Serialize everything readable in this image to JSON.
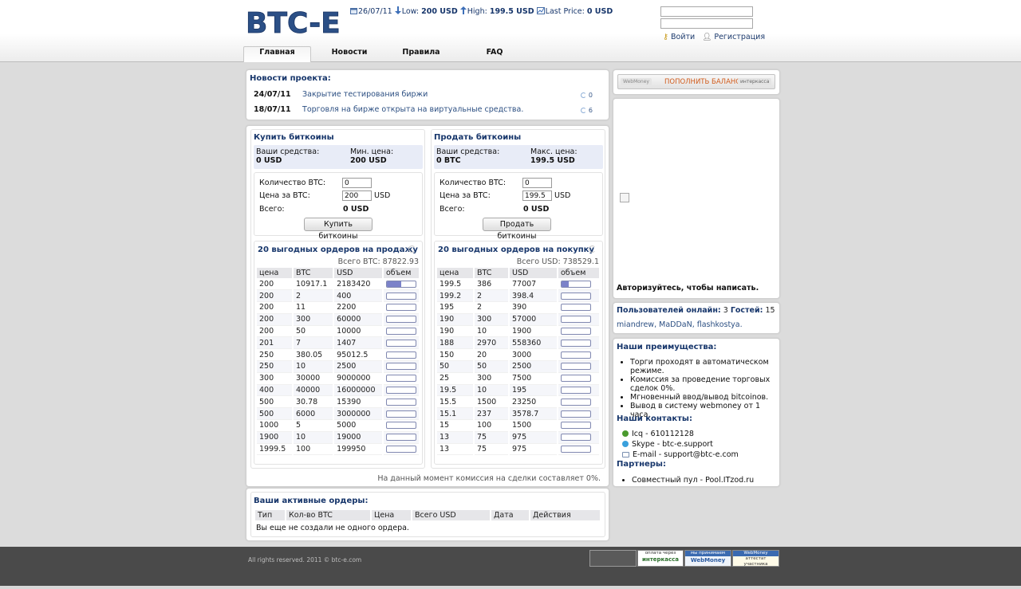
{
  "header": {
    "logo_text": "BTC-E",
    "ticker": {
      "date": "26/07/11",
      "low_label": "Low:",
      "low_value": "200 USD",
      "high_label": "High:",
      "high_value": "199.5 USD",
      "last_label": "Last Price:",
      "last_value": "0 USD"
    },
    "login": {
      "login_link": "Войти",
      "register_link": "Регистрация"
    },
    "nav": [
      "Главная",
      "Новости",
      "Правила",
      "FAQ"
    ]
  },
  "news": {
    "title": "Новости проекта:",
    "items": [
      {
        "date": "24/07/11",
        "text": "Закрытие тестирования биржи",
        "comments": "0"
      },
      {
        "date": "18/07/11",
        "text": "Торговля на бирже открыта на виртуальные средства.",
        "comments": "6"
      }
    ]
  },
  "buy": {
    "title": "Купить биткоины",
    "funds_label": "Ваши средства:",
    "funds_value": "0 USD",
    "price_label": "Мин. цена:",
    "price_value": "200 USD",
    "qty_label": "Количество BTC:",
    "qty_value": "0",
    "unit_price_label": "Цена за BTC:",
    "unit_price_value": "200",
    "unit_price_currency": "USD",
    "total_label": "Всего:",
    "total_value": "0 USD",
    "button": "Купить биткоины"
  },
  "sell": {
    "title": "Продать биткоины",
    "funds_label": "Ваши средства:",
    "funds_value": "0 BTC",
    "price_label": "Макс. цена:",
    "price_value": "199.5 USD",
    "qty_label": "Количество BTC:",
    "qty_value": "0",
    "unit_price_label": "Цена за BTC:",
    "unit_price_value": "199.5",
    "unit_price_currency": "USD",
    "total_label": "Всего:",
    "total_value": "0 USD",
    "button": "Продать биткоины"
  },
  "sell_orders": {
    "title": "20 выгодных ордеров на продажу",
    "total": "Всего BTC: 87822.93",
    "columns": [
      "цена",
      "BTC",
      "USD",
      "объем"
    ],
    "rows": [
      [
        "200",
        "10917.1",
        "2183420",
        0.5
      ],
      [
        "200",
        "2",
        "400",
        0
      ],
      [
        "200",
        "11",
        "2200",
        0
      ],
      [
        "200",
        "300",
        "60000",
        0
      ],
      [
        "200",
        "50",
        "10000",
        0
      ],
      [
        "201",
        "7",
        "1407",
        0
      ],
      [
        "250",
        "380.05",
        "95012.5",
        0
      ],
      [
        "250",
        "10",
        "2500",
        0
      ],
      [
        "300",
        "30000",
        "9000000",
        0
      ],
      [
        "400",
        "40000",
        "16000000",
        0
      ],
      [
        "500",
        "30.78",
        "15390",
        0
      ],
      [
        "500",
        "6000",
        "3000000",
        0
      ],
      [
        "1000",
        "5",
        "5000",
        0
      ],
      [
        "1900",
        "10",
        "19000",
        0
      ],
      [
        "1999.5",
        "100",
        "199950",
        0
      ]
    ]
  },
  "buy_orders": {
    "title": "20 выгодных ордеров на покупку",
    "total": "Всего USD: 738529.1",
    "columns": [
      "цена",
      "BTC",
      "USD",
      "объем"
    ],
    "rows": [
      [
        "199.5",
        "386",
        "77007",
        0.25
      ],
      [
        "199.2",
        "2",
        "398.4",
        0
      ],
      [
        "195",
        "2",
        "390",
        0
      ],
      [
        "190",
        "300",
        "57000",
        0
      ],
      [
        "190",
        "10",
        "1900",
        0
      ],
      [
        "188",
        "2970",
        "558360",
        0
      ],
      [
        "150",
        "20",
        "3000",
        0
      ],
      [
        "50",
        "50",
        "2500",
        0
      ],
      [
        "25",
        "300",
        "7500",
        0
      ],
      [
        "19.5",
        "10",
        "195",
        0
      ],
      [
        "15.5",
        "1500",
        "23250",
        0
      ],
      [
        "15.1",
        "237",
        "3578.7",
        0
      ],
      [
        "15",
        "100",
        "1500",
        0
      ],
      [
        "13",
        "75",
        "975",
        0
      ],
      [
        "13",
        "75",
        "975",
        0
      ]
    ]
  },
  "commission": "На данный момент комиссия на сделки составляет 0%.",
  "active_orders": {
    "title": "Ваши активные ордеры:",
    "columns": [
      "Тип",
      "Кол-во BTC",
      "Цена",
      "Всего USD",
      "Дата",
      "Действия"
    ],
    "empty": "Вы еще не создали не одного ордера."
  },
  "sidebar": {
    "topup": {
      "webmoney": "WebMoney",
      "label": "ПОПОЛНИТЬ БАЛАНС",
      "interkassa": "интеркасса"
    },
    "chat_login_prompt": "Авторизуйтесь, чтобы написать.",
    "online": {
      "label": "Пользователей онлайн:",
      "count": "3",
      "guests_label": "Гостей:",
      "guests": "15",
      "users": [
        "miandrew",
        "MaDDaN",
        "flashkostya"
      ]
    },
    "advantages_title": "Наши преимущества:",
    "advantages": [
      "Торги проходят в автоматическом режиме.",
      "Комиссия за проведение торговых сделок 0%.",
      "Мгновенный ввод/вывод bitcoinов.",
      "Вывод в систему webmoney от 1 часа."
    ],
    "contacts_title": "Наши контакты:",
    "contacts": {
      "icq": "Icq - 610112128",
      "skype": "Skype - btc-e.support",
      "email": "E-mail - support@btc-e.com"
    },
    "partners_title": "Партнеры:",
    "partners": [
      "Совместный пул - Pool.ITzod.ru"
    ]
  },
  "footer": {
    "copyright": "All rights reserved. 2011 © btc-e.com",
    "badges": {
      "interkassa_top": "оплата через",
      "interkassa": "интеркасса",
      "webmoney_top": "мы принимаем",
      "webmoney": "WebMoney",
      "attestat_top": "WebMoney",
      "attestat": "аттестат участника"
    }
  },
  "colors": {
    "title_blue": "#17366b",
    "link_blue": "#2c4f82",
    "volume_bar": "#7b82c9",
    "topup_orange": "#d05a1a",
    "footer_bg": "#4a4a4a"
  }
}
